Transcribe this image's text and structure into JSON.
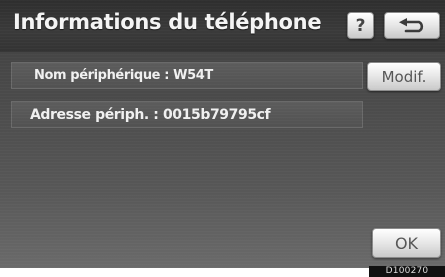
{
  "screen": {
    "title": "Informations du téléphone"
  },
  "toolbar": {
    "help_label": "?",
    "back_icon": "return-arrow-icon"
  },
  "fields": {
    "device_name": "Nom périphérique : W54T",
    "address": "Adresse périph. : 0015b79795cf"
  },
  "buttons": {
    "modify_label": "Modif.",
    "ok_label": "OK"
  },
  "image_code": "D100270"
}
